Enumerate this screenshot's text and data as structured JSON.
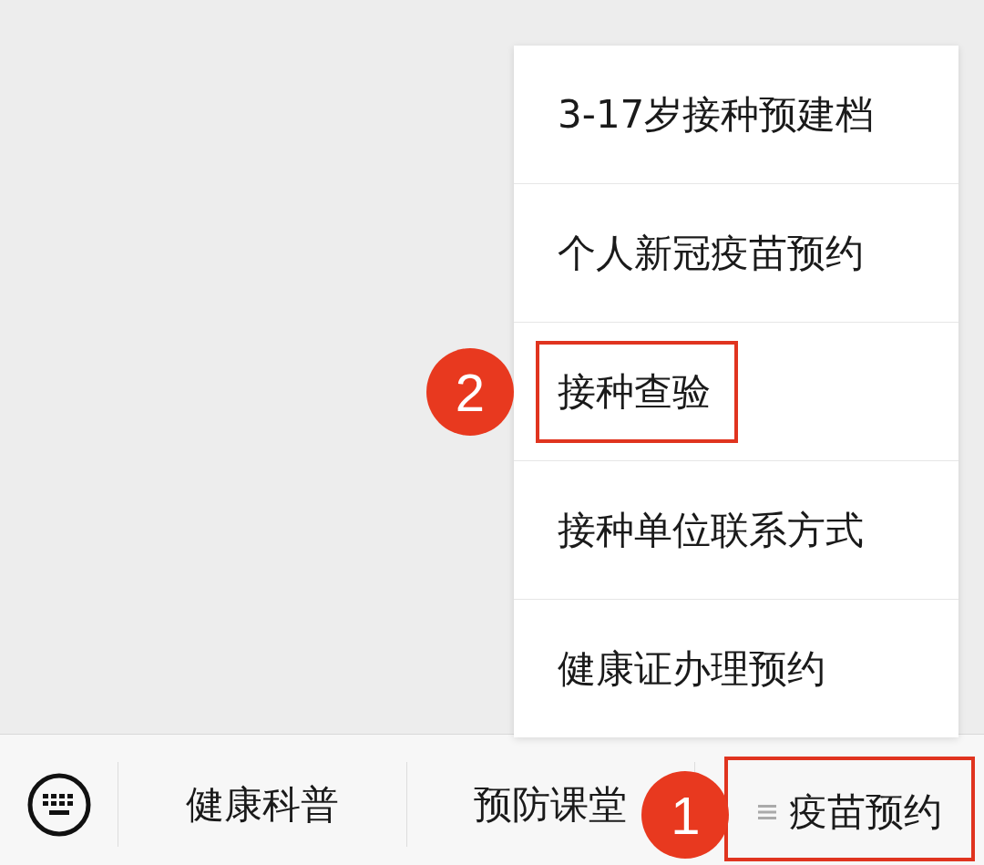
{
  "menu": {
    "items": [
      {
        "label": "3-17岁接种预建档",
        "highlighted": false
      },
      {
        "label": "个人新冠疫苗预约",
        "highlighted": false
      },
      {
        "label": "接种查验",
        "highlighted": true,
        "marker": "2"
      },
      {
        "label": "接种单位联系方式",
        "highlighted": false
      },
      {
        "label": "健康证办理预约",
        "highlighted": false
      }
    ]
  },
  "bottom_bar": {
    "tabs": [
      {
        "label": "健康科普",
        "has_menu": false,
        "highlighted": false
      },
      {
        "label": "预防课堂",
        "has_menu": false,
        "highlighted": false
      },
      {
        "label": "疫苗预约",
        "has_menu": true,
        "highlighted": true,
        "marker": "1"
      }
    ]
  }
}
